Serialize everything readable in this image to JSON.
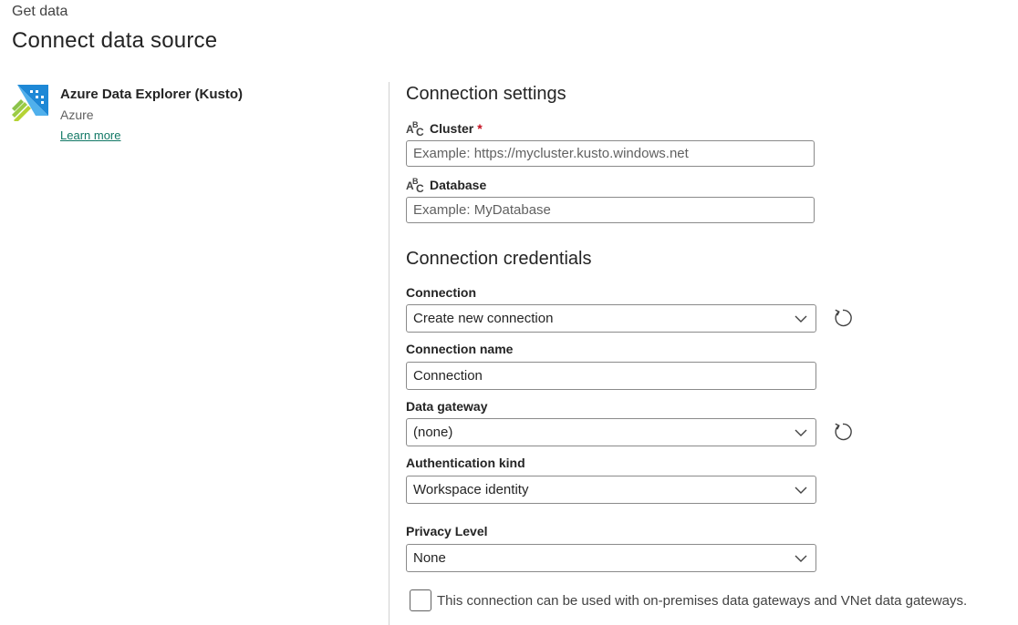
{
  "header": {
    "breadcrumb": "Get data",
    "title": "Connect data source"
  },
  "connector": {
    "name": "Azure Data Explorer (Kusto)",
    "vendor": "Azure",
    "learn_more": "Learn more",
    "icon": "azure-data-explorer-logo"
  },
  "settings": {
    "title": "Connection settings",
    "cluster": {
      "label": "Cluster",
      "required_mark": "*",
      "placeholder": "Example: https://mycluster.kusto.windows.net",
      "value": ""
    },
    "database": {
      "label": "Database",
      "placeholder": "Example: MyDatabase",
      "value": ""
    }
  },
  "credentials": {
    "title": "Connection credentials",
    "connection": {
      "label": "Connection",
      "value": "Create new connection"
    },
    "connection_name": {
      "label": "Connection name",
      "value": "Connection"
    },
    "data_gateway": {
      "label": "Data gateway",
      "value": "(none)"
    },
    "auth_kind": {
      "label": "Authentication kind",
      "value": "Workspace identity"
    },
    "privacy": {
      "label": "Privacy Level",
      "value": "None"
    },
    "gateway_checkbox": {
      "label": "This connection can be used with on-premises data gateways and VNet data gateways.",
      "checked": false
    }
  },
  "colors": {
    "accent": "#117865",
    "required": "#c50f1f",
    "border": "#8a8a8a",
    "divider": "#d1d1d1"
  }
}
